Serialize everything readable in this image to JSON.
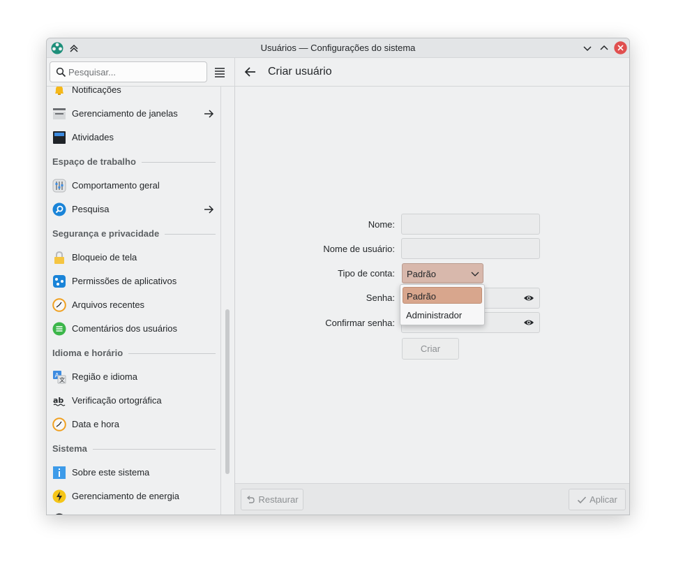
{
  "window": {
    "title": "Usuários — Configurações do sistema"
  },
  "header": {
    "search_placeholder": "Pesquisar...",
    "page_title": "Criar usuário"
  },
  "sidebar": {
    "items": [
      {
        "label": "Notificações",
        "icon": "bell-icon",
        "arrow": false
      },
      {
        "label": "Gerenciamento de janelas",
        "icon": "window-management-icon",
        "arrow": true
      },
      {
        "label": "Atividades",
        "icon": "activities-icon",
        "arrow": false
      },
      {
        "section": "Espaço de trabalho"
      },
      {
        "label": "Comportamento geral",
        "icon": "general-behavior-icon",
        "arrow": false
      },
      {
        "label": "Pesquisa",
        "icon": "search-settings-icon",
        "arrow": true
      },
      {
        "section": "Segurança e privacidade"
      },
      {
        "label": "Bloqueio de tela",
        "icon": "lock-icon",
        "arrow": false
      },
      {
        "label": "Permissões de aplicativos",
        "icon": "app-permissions-icon",
        "arrow": false
      },
      {
        "label": "Arquivos recentes",
        "icon": "clock-icon",
        "arrow": false
      },
      {
        "label": "Comentários dos usuários",
        "icon": "feedback-icon",
        "arrow": false
      },
      {
        "section": "Idioma e horário"
      },
      {
        "label": "Região e idioma",
        "icon": "language-icon",
        "arrow": false
      },
      {
        "label": "Verificação ortográfica",
        "icon": "spellcheck-icon",
        "arrow": false
      },
      {
        "label": "Data e hora",
        "icon": "clock-icon",
        "arrow": false
      },
      {
        "section": "Sistema"
      },
      {
        "label": "Sobre este sistema",
        "icon": "info-icon",
        "arrow": false
      },
      {
        "label": "Gerenciamento de energia",
        "icon": "power-icon",
        "arrow": false
      }
    ]
  },
  "form": {
    "name_label": "Nome:",
    "username_label": "Nome de usuário:",
    "account_type_label": "Tipo de conta:",
    "account_type_value": "Padrão",
    "account_type_options": [
      "Padrão",
      "Administrador"
    ],
    "password_label": "Senha:",
    "confirm_password_label": "Confirmar senha:",
    "name_value": "",
    "username_value": "",
    "create_label": "Criar"
  },
  "footer": {
    "restore_label": "Restaurar",
    "apply_label": "Aplicar"
  },
  "colors": {
    "accent": "#d8a68d",
    "combo": "#d8b8ac",
    "close": "#e04f4f"
  }
}
